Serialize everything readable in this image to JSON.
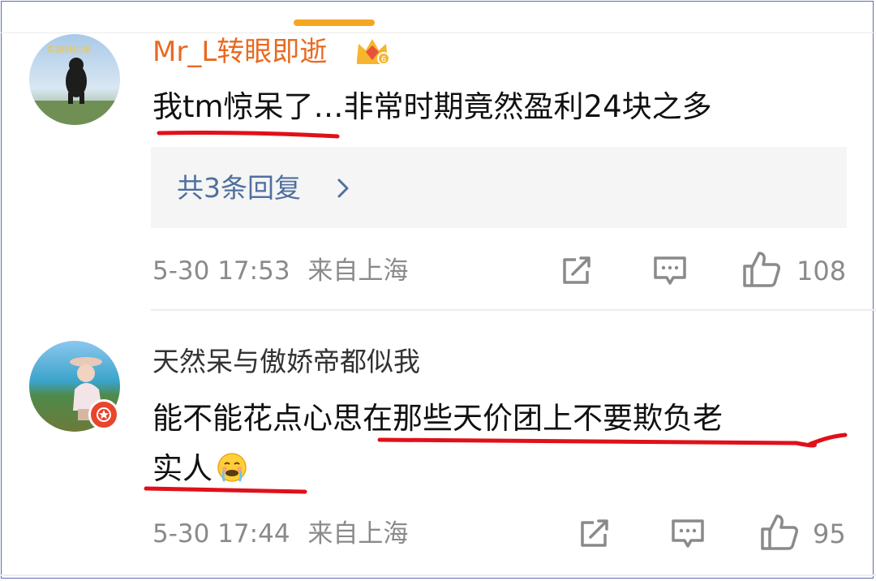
{
  "comments": [
    {
      "username": "Mr_L转眼即逝",
      "avatar_caption": "高温给我力量",
      "text": "我tm惊呆了…非常时期竟然盈利24块之多",
      "reply_link": "共3条回复",
      "timestamp": "5-30 17:53",
      "location": "来自上海",
      "likes": "108"
    },
    {
      "username": "天然呆与傲娇帝都似我",
      "text_line1": "能不能花点心思在那些天价团上不要欺负老",
      "text_line2": "实人",
      "timestamp": "5-30 17:44",
      "location": "来自上海",
      "likes": "95"
    }
  ],
  "colors": {
    "vip_username": "#e86a21",
    "reply_link": "#4f6f9f",
    "annotation_underline": "#e0101a",
    "meta_text": "#8a8a8a"
  },
  "icons": [
    "vip-crown-icon",
    "chevron-right-icon",
    "share-icon",
    "comment-icon",
    "thumbs-up-icon",
    "verified-badge-icon",
    "smiley-emoji-icon"
  ]
}
